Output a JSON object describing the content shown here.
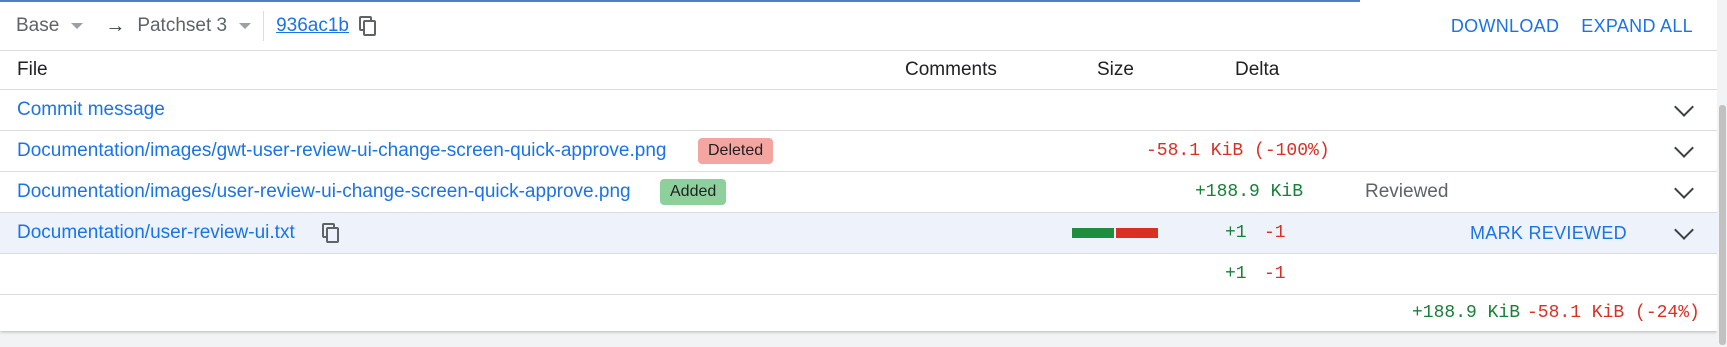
{
  "header": {
    "base_label": "Base",
    "arrow": "→",
    "patchset_label": "Patchset 3",
    "commit_hash": "936ac1b",
    "download": "DOWNLOAD",
    "expand_all": "EXPAND ALL"
  },
  "columns": {
    "file": "File",
    "comments": "Comments",
    "size": "Size",
    "delta": "Delta"
  },
  "rows": [
    {
      "name": "Commit message"
    },
    {
      "name": "Documentation/images/gwt-user-review-ui-change-screen-quick-approve.png",
      "badge": "Deleted",
      "size_delta": "-58.1 KiB (-100%)"
    },
    {
      "name": "Documentation/images/user-review-ui-change-screen-quick-approve.png",
      "badge": "Added",
      "size_delta": "+188.9 KiB",
      "status": "Reviewed"
    },
    {
      "name": "Documentation/user-review-ui.txt",
      "lines_added": "+1",
      "lines_removed": "-1",
      "action": "MARK REVIEWED"
    }
  ],
  "totals": {
    "lines_added": "+1",
    "lines_removed": "-1",
    "size_added": "+188.9 KiB",
    "size_removed": "-58.1 KiB (-24%)"
  },
  "colors": {
    "link": "#1a73e8",
    "added": "#188038",
    "removed": "#d93025",
    "deleted_badge": "#f5a5a0",
    "added_badge": "#8ed09b"
  }
}
